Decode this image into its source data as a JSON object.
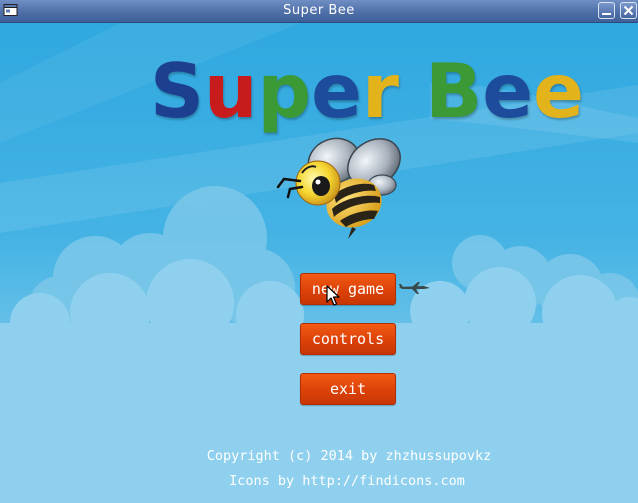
{
  "window": {
    "title": "Super Bee",
    "minimize_icon": "minimize-icon",
    "close_icon": "close-icon"
  },
  "game": {
    "title_letters": [
      {
        "char": "S",
        "color": "#1d3f8f"
      },
      {
        "char": "u",
        "color": "#c81c1c"
      },
      {
        "char": "p",
        "color": "#3b9a35"
      },
      {
        "char": "e",
        "color": "#1d4c9c"
      },
      {
        "char": "r",
        "color": "#e2b31a"
      },
      {
        "char": " ",
        "color": "#ffffff"
      },
      {
        "char": "B",
        "color": "#3b9a35"
      },
      {
        "char": "e",
        "color": "#1d4c9c"
      },
      {
        "char": "e",
        "color": "#e2b31a"
      }
    ],
    "menu": {
      "new_game": "new game",
      "controls": "controls",
      "exit": "exit"
    },
    "footer": {
      "copyright": "Copyright (c) 2014 by zhzhussupovkz",
      "icons_credit": "Icons by http://findicons.com"
    }
  }
}
